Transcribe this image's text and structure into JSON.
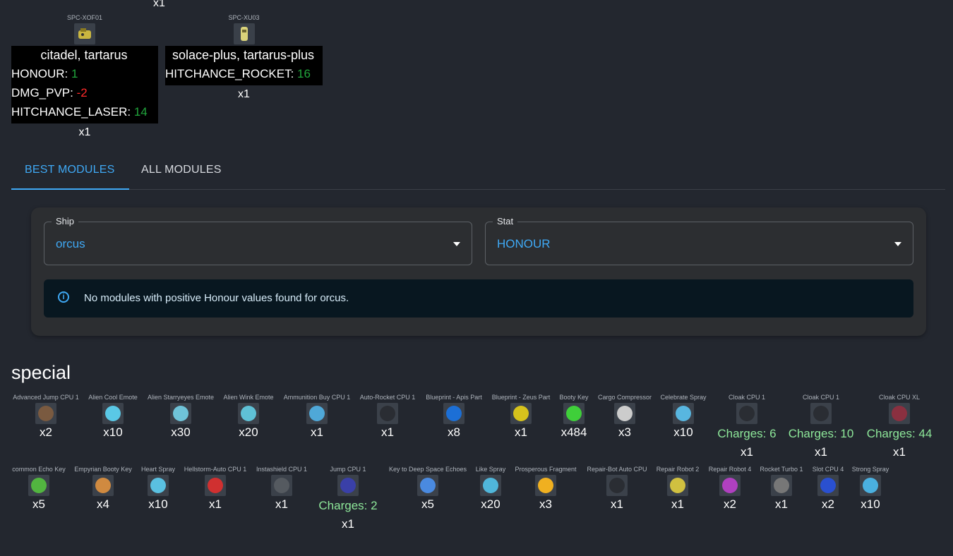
{
  "top": {
    "stray_qty": "x1",
    "cards": [
      {
        "code": "SPC-XOF01",
        "header": "citadel, tartarus",
        "stats": [
          {
            "k": "HONOUR:",
            "v": "1",
            "sign": "pos"
          },
          {
            "k": "DMG_PVP:",
            "v": "-2",
            "sign": "neg"
          },
          {
            "k": "HITCHANCE_LASER:",
            "v": "14",
            "sign": "pos"
          }
        ],
        "qty": "x1",
        "color": "#c9b640"
      },
      {
        "code": "SPC-XU03",
        "header": "solace-plus, tartarus-plus",
        "stats": [
          {
            "k": "HITCHANCE_ROCKET:",
            "v": "16",
            "sign": "pos"
          }
        ],
        "qty": "x1",
        "color": "#d9d27a"
      }
    ]
  },
  "tabs": [
    {
      "label": "BEST MODULES"
    },
    {
      "label": "ALL MODULES"
    }
  ],
  "filters": {
    "ship": {
      "label": "Ship",
      "value": "orcus"
    },
    "stat": {
      "label": "Stat",
      "value": "HONOUR"
    }
  },
  "alert": {
    "icon": "i",
    "message": "No modules with positive Honour values found for orcus."
  },
  "section": {
    "title": "special"
  },
  "items_row1": [
    {
      "name": "Advanced Jump CPU 1",
      "qty": "x2",
      "charges": "",
      "color": "#7a5a40"
    },
    {
      "name": "Alien Cool Emote",
      "qty": "x10",
      "charges": "",
      "color": "#5ac8e6"
    },
    {
      "name": "Alien Starryeyes Emote",
      "qty": "x30",
      "charges": "",
      "color": "#6fc3d8"
    },
    {
      "name": "Alien Wink Emote",
      "qty": "x20",
      "charges": "",
      "color": "#5fc1d6"
    },
    {
      "name": "Ammunition Buy CPU 1",
      "qty": "x1",
      "charges": "",
      "color": "#4fa8d8"
    },
    {
      "name": "Auto-Rocket CPU 1",
      "qty": "x1",
      "charges": "",
      "color": "#2a2d33"
    },
    {
      "name": "Blueprint - Apis Part",
      "qty": "x8",
      "charges": "",
      "color": "#1c6fd6"
    },
    {
      "name": "Blueprint - Zeus Part",
      "qty": "x1",
      "charges": "",
      "color": "#d6c21c"
    },
    {
      "name": "Booty Key",
      "qty": "x484",
      "charges": "",
      "color": "#3fcf3a"
    },
    {
      "name": "Cargo Compressor",
      "qty": "x3",
      "charges": "",
      "color": "#cccccc"
    },
    {
      "name": "Celebrate Spray",
      "qty": "x10",
      "charges": "",
      "color": "#58b6e0"
    },
    {
      "name": "Cloak CPU 1",
      "qty": "x1",
      "charges": "Charges: 6",
      "color": "#2a2d33"
    },
    {
      "name": "Cloak CPU 1",
      "qty": "x1",
      "charges": "Charges: 10",
      "color": "#2a2d33"
    },
    {
      "name": "Cloak CPU XL",
      "qty": "x1",
      "charges": "Charges: 44",
      "color": "#8a3040"
    }
  ],
  "items_row2": [
    {
      "name": "common Echo Key",
      "qty": "x5",
      "charges": "",
      "color": "#52b540"
    },
    {
      "name": "Empyrian Booty Key",
      "qty": "x4",
      "charges": "",
      "color": "#d08a40"
    },
    {
      "name": "Heart Spray",
      "qty": "x10",
      "charges": "",
      "color": "#5ac0e0"
    },
    {
      "name": "Hellstorm-Auto CPU 1",
      "qty": "x1",
      "charges": "",
      "color": "#d03030"
    },
    {
      "name": "Instashield CPU 1",
      "qty": "x1",
      "charges": "",
      "color": "#555a60"
    },
    {
      "name": "Jump CPU 1",
      "qty": "x1",
      "charges": "Charges: 2",
      "color": "#3a40a8"
    },
    {
      "name": "Key to Deep Space Echoes",
      "qty": "x5",
      "charges": "",
      "color": "#4a8ae0"
    },
    {
      "name": "Like Spray",
      "qty": "x20",
      "charges": "",
      "color": "#50b6da"
    },
    {
      "name": "Prosperous Fragment",
      "qty": "x3",
      "charges": "",
      "color": "#f0b020"
    },
    {
      "name": "Repair-Bot Auto CPU",
      "qty": "x1",
      "charges": "",
      "color": "#2a2d33"
    },
    {
      "name": "Repair Robot 2",
      "qty": "x1",
      "charges": "",
      "color": "#d0c040"
    },
    {
      "name": "Repair Robot 4",
      "qty": "x2",
      "charges": "",
      "color": "#b040c0"
    },
    {
      "name": "Rocket Turbo 1",
      "qty": "x1",
      "charges": "",
      "color": "#777777"
    },
    {
      "name": "Slot CPU 4",
      "qty": "x2",
      "charges": "",
      "color": "#2a50d0"
    },
    {
      "name": "Strong Spray",
      "qty": "x10",
      "charges": "",
      "color": "#4ab0e0"
    }
  ]
}
